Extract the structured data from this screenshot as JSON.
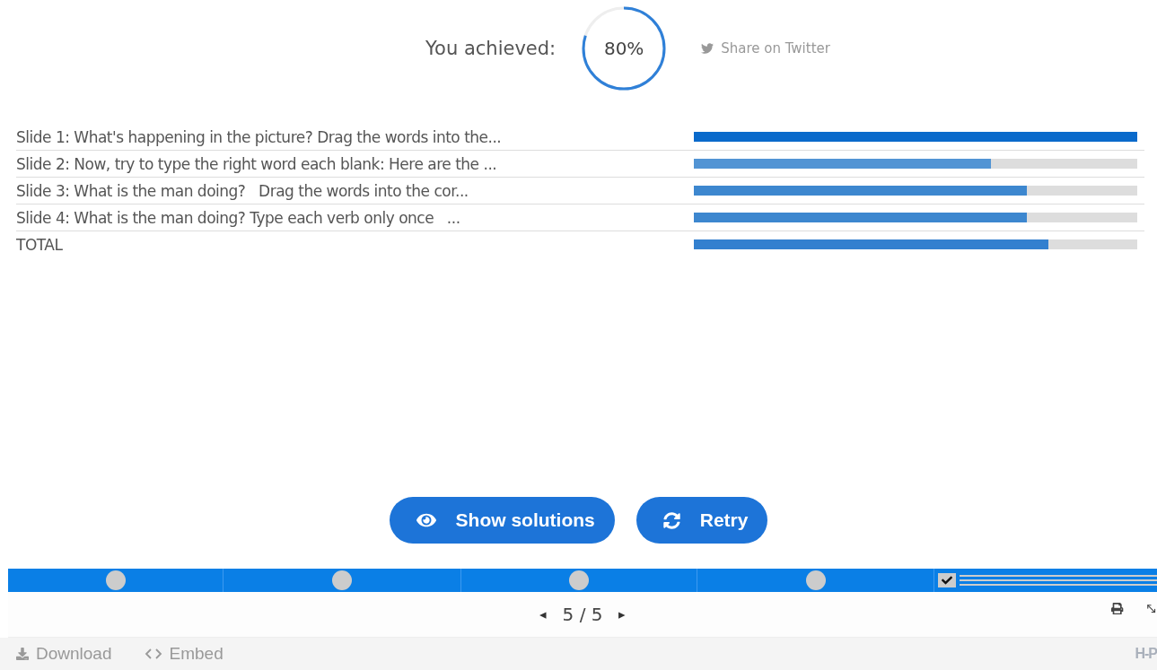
{
  "score": {
    "label": "You achieved:",
    "value": "80%",
    "share": "Share on Twitter"
  },
  "results": [
    {
      "label": "Slide 1: What's happening in the picture? Drag the words into the...",
      "level": 1.0,
      "color": "#0a6acb"
    },
    {
      "label": "Slide 2: Now, try to type the right word each blank: Here are the ...",
      "level": 0.67,
      "color": "#5294d4"
    },
    {
      "label": "Slide 3: What is the man doing?   Drag the words into the cor...",
      "level": 0.75,
      "color": "#3d87cf"
    },
    {
      "label": "Slide 4: What is the man doing? Type each verb only once   ...",
      "level": 0.75,
      "color": "#3d87cf"
    },
    {
      "label": "TOTAL",
      "level": 0.8,
      "color": "#3380cf"
    }
  ],
  "buttons": [
    {
      "label": "Show solutions",
      "kind": "solutions"
    },
    {
      "label": "Retry",
      "kind": "retry"
    }
  ],
  "progress": [
    {
      "kind": "dot"
    },
    {
      "kind": "dot"
    },
    {
      "kind": "dot"
    },
    {
      "kind": "dot"
    },
    {
      "kind": "summary",
      "checked": true
    }
  ],
  "pager": {
    "prev": "◂",
    "text": "5 / 5",
    "next": "▸"
  },
  "footer": {
    "download": "Download",
    "embed": "Embed",
    "logo": "H-P"
  }
}
